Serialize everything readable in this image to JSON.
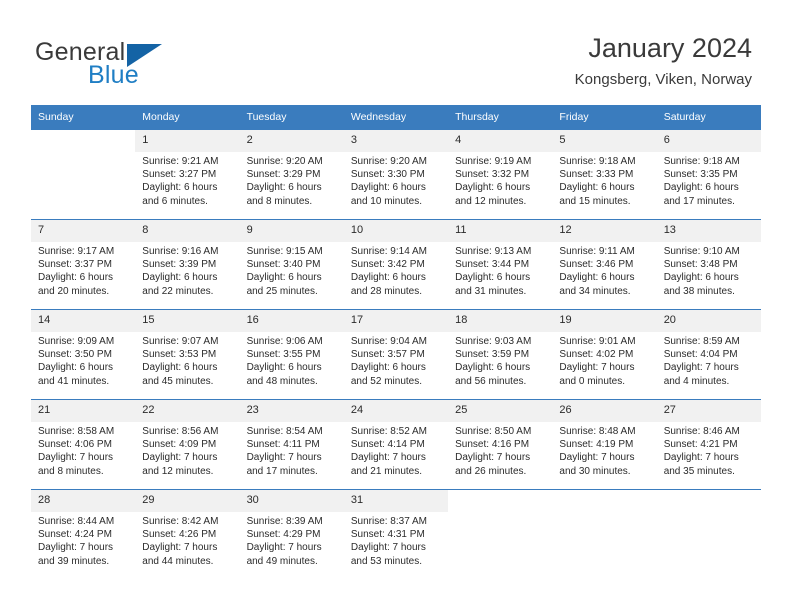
{
  "brand": {
    "name_top": "General",
    "name_bottom": "Blue",
    "accent_color": "#1f7ec4",
    "triangle_color": "#1463a5"
  },
  "header": {
    "title": "January 2024",
    "subtitle": "Kongsberg, Viken, Norway"
  },
  "theme": {
    "header_row_bg": "#3a7cbe",
    "header_row_text": "#ffffff",
    "daynum_bg": "#f1f1f1",
    "cell_bg": "#ffffff",
    "text_color": "#2b2b2b"
  },
  "weekday_headers": [
    "Sunday",
    "Monday",
    "Tuesday",
    "Wednesday",
    "Thursday",
    "Friday",
    "Saturday"
  ],
  "weeks": [
    [
      {
        "day": ""
      },
      {
        "day": "1",
        "sunrise": "Sunrise: 9:21 AM",
        "sunset": "Sunset: 3:27 PM",
        "daylight": "Daylight: 6 hours and 6 minutes."
      },
      {
        "day": "2",
        "sunrise": "Sunrise: 9:20 AM",
        "sunset": "Sunset: 3:29 PM",
        "daylight": "Daylight: 6 hours and 8 minutes."
      },
      {
        "day": "3",
        "sunrise": "Sunrise: 9:20 AM",
        "sunset": "Sunset: 3:30 PM",
        "daylight": "Daylight: 6 hours and 10 minutes."
      },
      {
        "day": "4",
        "sunrise": "Sunrise: 9:19 AM",
        "sunset": "Sunset: 3:32 PM",
        "daylight": "Daylight: 6 hours and 12 minutes."
      },
      {
        "day": "5",
        "sunrise": "Sunrise: 9:18 AM",
        "sunset": "Sunset: 3:33 PM",
        "daylight": "Daylight: 6 hours and 15 minutes."
      },
      {
        "day": "6",
        "sunrise": "Sunrise: 9:18 AM",
        "sunset": "Sunset: 3:35 PM",
        "daylight": "Daylight: 6 hours and 17 minutes."
      }
    ],
    [
      {
        "day": "7",
        "sunrise": "Sunrise: 9:17 AM",
        "sunset": "Sunset: 3:37 PM",
        "daylight": "Daylight: 6 hours and 20 minutes."
      },
      {
        "day": "8",
        "sunrise": "Sunrise: 9:16 AM",
        "sunset": "Sunset: 3:39 PM",
        "daylight": "Daylight: 6 hours and 22 minutes."
      },
      {
        "day": "9",
        "sunrise": "Sunrise: 9:15 AM",
        "sunset": "Sunset: 3:40 PM",
        "daylight": "Daylight: 6 hours and 25 minutes."
      },
      {
        "day": "10",
        "sunrise": "Sunrise: 9:14 AM",
        "sunset": "Sunset: 3:42 PM",
        "daylight": "Daylight: 6 hours and 28 minutes."
      },
      {
        "day": "11",
        "sunrise": "Sunrise: 9:13 AM",
        "sunset": "Sunset: 3:44 PM",
        "daylight": "Daylight: 6 hours and 31 minutes."
      },
      {
        "day": "12",
        "sunrise": "Sunrise: 9:11 AM",
        "sunset": "Sunset: 3:46 PM",
        "daylight": "Daylight: 6 hours and 34 minutes."
      },
      {
        "day": "13",
        "sunrise": "Sunrise: 9:10 AM",
        "sunset": "Sunset: 3:48 PM",
        "daylight": "Daylight: 6 hours and 38 minutes."
      }
    ],
    [
      {
        "day": "14",
        "sunrise": "Sunrise: 9:09 AM",
        "sunset": "Sunset: 3:50 PM",
        "daylight": "Daylight: 6 hours and 41 minutes."
      },
      {
        "day": "15",
        "sunrise": "Sunrise: 9:07 AM",
        "sunset": "Sunset: 3:53 PM",
        "daylight": "Daylight: 6 hours and 45 minutes."
      },
      {
        "day": "16",
        "sunrise": "Sunrise: 9:06 AM",
        "sunset": "Sunset: 3:55 PM",
        "daylight": "Daylight: 6 hours and 48 minutes."
      },
      {
        "day": "17",
        "sunrise": "Sunrise: 9:04 AM",
        "sunset": "Sunset: 3:57 PM",
        "daylight": "Daylight: 6 hours and 52 minutes."
      },
      {
        "day": "18",
        "sunrise": "Sunrise: 9:03 AM",
        "sunset": "Sunset: 3:59 PM",
        "daylight": "Daylight: 6 hours and 56 minutes."
      },
      {
        "day": "19",
        "sunrise": "Sunrise: 9:01 AM",
        "sunset": "Sunset: 4:02 PM",
        "daylight": "Daylight: 7 hours and 0 minutes."
      },
      {
        "day": "20",
        "sunrise": "Sunrise: 8:59 AM",
        "sunset": "Sunset: 4:04 PM",
        "daylight": "Daylight: 7 hours and 4 minutes."
      }
    ],
    [
      {
        "day": "21",
        "sunrise": "Sunrise: 8:58 AM",
        "sunset": "Sunset: 4:06 PM",
        "daylight": "Daylight: 7 hours and 8 minutes."
      },
      {
        "day": "22",
        "sunrise": "Sunrise: 8:56 AM",
        "sunset": "Sunset: 4:09 PM",
        "daylight": "Daylight: 7 hours and 12 minutes."
      },
      {
        "day": "23",
        "sunrise": "Sunrise: 8:54 AM",
        "sunset": "Sunset: 4:11 PM",
        "daylight": "Daylight: 7 hours and 17 minutes."
      },
      {
        "day": "24",
        "sunrise": "Sunrise: 8:52 AM",
        "sunset": "Sunset: 4:14 PM",
        "daylight": "Daylight: 7 hours and 21 minutes."
      },
      {
        "day": "25",
        "sunrise": "Sunrise: 8:50 AM",
        "sunset": "Sunset: 4:16 PM",
        "daylight": "Daylight: 7 hours and 26 minutes."
      },
      {
        "day": "26",
        "sunrise": "Sunrise: 8:48 AM",
        "sunset": "Sunset: 4:19 PM",
        "daylight": "Daylight: 7 hours and 30 minutes."
      },
      {
        "day": "27",
        "sunrise": "Sunrise: 8:46 AM",
        "sunset": "Sunset: 4:21 PM",
        "daylight": "Daylight: 7 hours and 35 minutes."
      }
    ],
    [
      {
        "day": "28",
        "sunrise": "Sunrise: 8:44 AM",
        "sunset": "Sunset: 4:24 PM",
        "daylight": "Daylight: 7 hours and 39 minutes."
      },
      {
        "day": "29",
        "sunrise": "Sunrise: 8:42 AM",
        "sunset": "Sunset: 4:26 PM",
        "daylight": "Daylight: 7 hours and 44 minutes."
      },
      {
        "day": "30",
        "sunrise": "Sunrise: 8:39 AM",
        "sunset": "Sunset: 4:29 PM",
        "daylight": "Daylight: 7 hours and 49 minutes."
      },
      {
        "day": "31",
        "sunrise": "Sunrise: 8:37 AM",
        "sunset": "Sunset: 4:31 PM",
        "daylight": "Daylight: 7 hours and 53 minutes."
      },
      {
        "day": ""
      },
      {
        "day": ""
      },
      {
        "day": ""
      }
    ]
  ]
}
